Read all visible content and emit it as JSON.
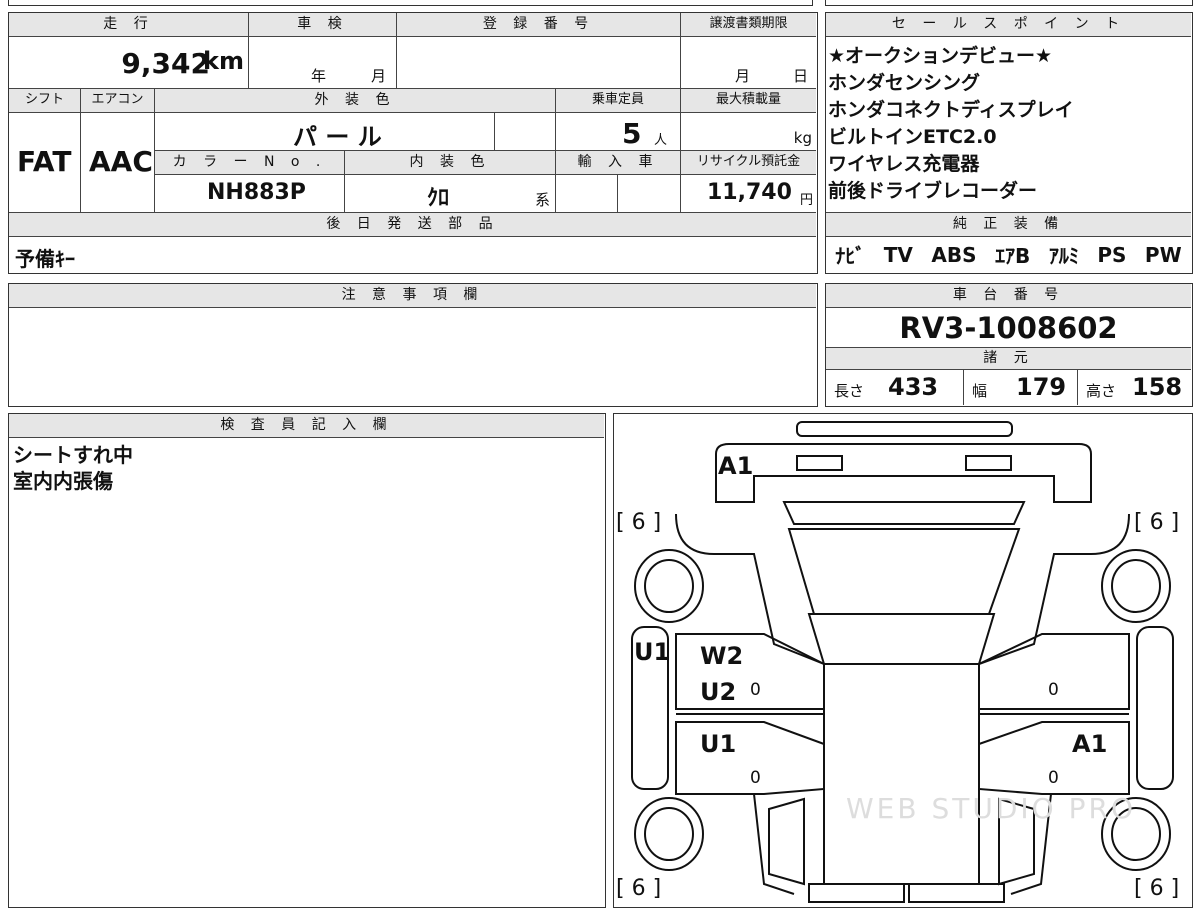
{
  "mileage": {
    "label": "走 行",
    "value": "9,342",
    "unit": "km"
  },
  "inspection": {
    "label": "車 検",
    "year": "年",
    "month": "月"
  },
  "registration": {
    "label": "登 録 番 号",
    "value": ""
  },
  "transfer_deadline": {
    "label": "譲渡書類期限",
    "month": "月",
    "day": "日"
  },
  "sales_points": {
    "label": "セ ー ル ス ポ イ ン ト",
    "items": [
      "★オークションデビュー★",
      "ホンダセンシング",
      "ホンダコネクトディスプレイ",
      "ビルトインETC2.0",
      "ワイヤレス充電器",
      "前後ドライブレコーダー"
    ]
  },
  "shift": {
    "label": "シフト",
    "value": "FAT"
  },
  "aircon": {
    "label": "エアコン",
    "value": "AAC"
  },
  "exterior_color": {
    "label": "外 装 色",
    "value": "パ ー ル"
  },
  "capacity": {
    "label": "乗車定員",
    "value": "5",
    "unit": "人"
  },
  "max_load": {
    "label": "最大積載量",
    "unit": "kg"
  },
  "color_no": {
    "label": "カ ラ ー N o .",
    "value": "NH883P"
  },
  "interior_color": {
    "label": "内 装 色",
    "value": "ｸﾛ",
    "suffix": "系"
  },
  "import": {
    "label": "輸 入 車"
  },
  "recycle": {
    "label": "リサイクル預託金",
    "value": "11,740",
    "unit": "円"
  },
  "later_parts": {
    "label": "後 日 発 送 部 品",
    "value": "予備ｷｰ"
  },
  "genuine_equipment": {
    "label": "純 正 装 備",
    "items": [
      "ﾅﾋﾞ",
      "TV",
      "ABS",
      "ｴｱB",
      "ｱﾙﾐ",
      "PS",
      "PW"
    ]
  },
  "notes": {
    "label": "注 意 事 項 欄",
    "value": ""
  },
  "chassis": {
    "label": "車 台 番 号",
    "value": "RV3-1008602"
  },
  "specs": {
    "label": "諸 元",
    "length_label": "長さ",
    "length": "433",
    "width_label": "幅",
    "width": "179",
    "height_label": "高さ",
    "height": "158"
  },
  "inspector": {
    "label": "検 査 員 記 入 欄",
    "lines": [
      "シートすれ中",
      "室内内張傷"
    ]
  },
  "diagram": {
    "marks": {
      "front": "A1",
      "left_quarter": "U1",
      "left_rear_door_top": "W2",
      "left_rear_door_bottom": "U2",
      "left_front_door": "U1",
      "right_front_door": "A1"
    },
    "tire_depth": [
      "[ 6 ]",
      "[ 6 ]",
      "[ 6 ]",
      "[ 6 ]"
    ],
    "zeros": [
      "0",
      "0",
      "0",
      "0"
    ],
    "watermark": "WEB STUDIO PRO"
  }
}
